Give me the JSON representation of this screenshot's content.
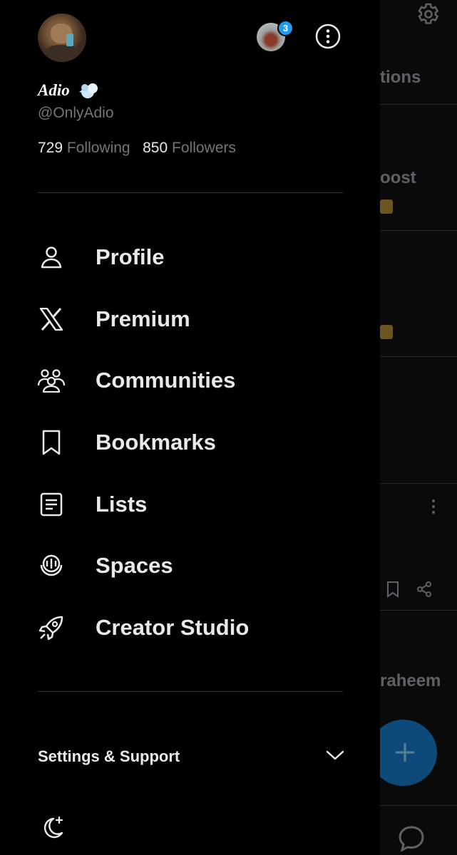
{
  "user": {
    "display_name": "Adio",
    "handle": "@OnlyAdio",
    "following_count": "729",
    "following_label": "Following",
    "followers_count": "850",
    "followers_label": "Followers"
  },
  "accounts": {
    "notification_badge": "3"
  },
  "nav": {
    "items": [
      {
        "label": "Profile",
        "icon": "person-icon"
      },
      {
        "label": "Premium",
        "icon": "x-logo-icon"
      },
      {
        "label": "Communities",
        "icon": "communities-icon"
      },
      {
        "label": "Bookmarks",
        "icon": "bookmark-icon"
      },
      {
        "label": "Lists",
        "icon": "list-icon"
      },
      {
        "label": "Spaces",
        "icon": "spaces-icon"
      },
      {
        "label": "Creator Studio",
        "icon": "rocket-icon"
      }
    ]
  },
  "settings": {
    "label": "Settings & Support"
  },
  "background": {
    "tab_fragment": "tions",
    "post_fragment": "oost",
    "name_fragment": "raheem"
  },
  "colors": {
    "accent": "#1d9bf0",
    "background": "#000000",
    "muted": "#71767b"
  }
}
